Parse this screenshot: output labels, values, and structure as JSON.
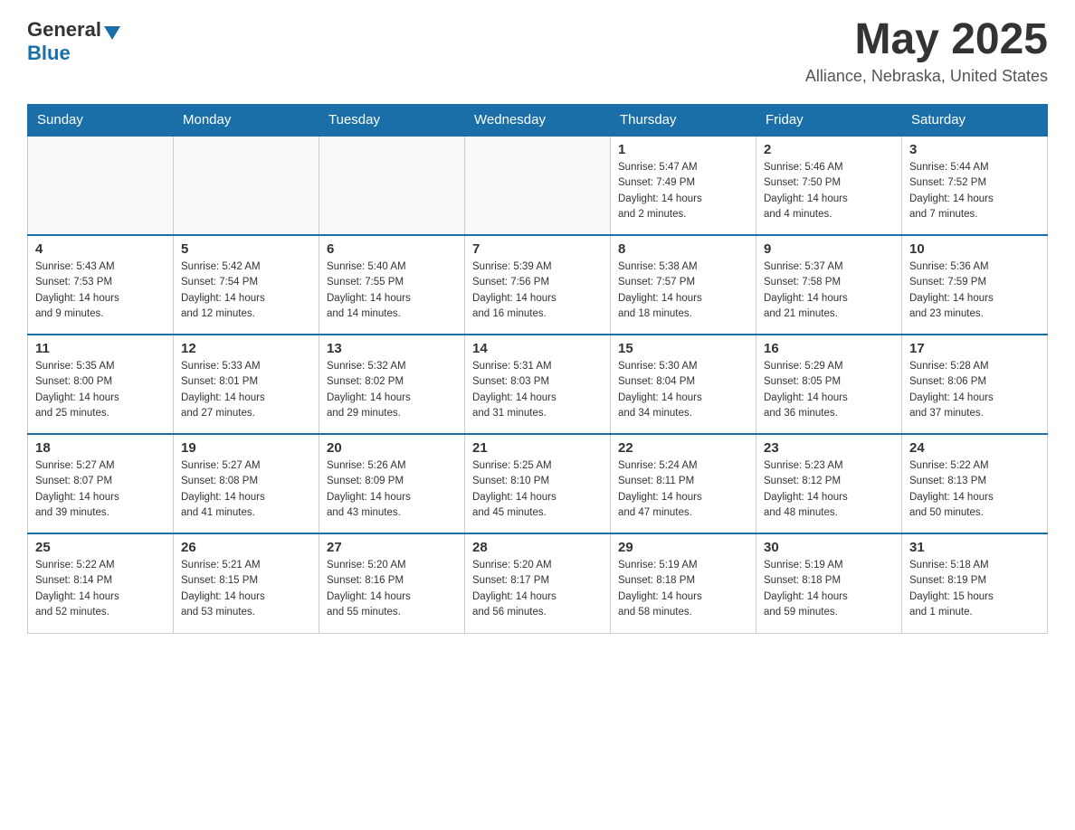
{
  "header": {
    "logo_general": "General",
    "logo_blue": "Blue",
    "month_title": "May 2025",
    "location": "Alliance, Nebraska, United States"
  },
  "days_of_week": [
    "Sunday",
    "Monday",
    "Tuesday",
    "Wednesday",
    "Thursday",
    "Friday",
    "Saturday"
  ],
  "weeks": [
    {
      "days": [
        {
          "number": "",
          "info": ""
        },
        {
          "number": "",
          "info": ""
        },
        {
          "number": "",
          "info": ""
        },
        {
          "number": "",
          "info": ""
        },
        {
          "number": "1",
          "info": "Sunrise: 5:47 AM\nSunset: 7:49 PM\nDaylight: 14 hours\nand 2 minutes."
        },
        {
          "number": "2",
          "info": "Sunrise: 5:46 AM\nSunset: 7:50 PM\nDaylight: 14 hours\nand 4 minutes."
        },
        {
          "number": "3",
          "info": "Sunrise: 5:44 AM\nSunset: 7:52 PM\nDaylight: 14 hours\nand 7 minutes."
        }
      ]
    },
    {
      "days": [
        {
          "number": "4",
          "info": "Sunrise: 5:43 AM\nSunset: 7:53 PM\nDaylight: 14 hours\nand 9 minutes."
        },
        {
          "number": "5",
          "info": "Sunrise: 5:42 AM\nSunset: 7:54 PM\nDaylight: 14 hours\nand 12 minutes."
        },
        {
          "number": "6",
          "info": "Sunrise: 5:40 AM\nSunset: 7:55 PM\nDaylight: 14 hours\nand 14 minutes."
        },
        {
          "number": "7",
          "info": "Sunrise: 5:39 AM\nSunset: 7:56 PM\nDaylight: 14 hours\nand 16 minutes."
        },
        {
          "number": "8",
          "info": "Sunrise: 5:38 AM\nSunset: 7:57 PM\nDaylight: 14 hours\nand 18 minutes."
        },
        {
          "number": "9",
          "info": "Sunrise: 5:37 AM\nSunset: 7:58 PM\nDaylight: 14 hours\nand 21 minutes."
        },
        {
          "number": "10",
          "info": "Sunrise: 5:36 AM\nSunset: 7:59 PM\nDaylight: 14 hours\nand 23 minutes."
        }
      ]
    },
    {
      "days": [
        {
          "number": "11",
          "info": "Sunrise: 5:35 AM\nSunset: 8:00 PM\nDaylight: 14 hours\nand 25 minutes."
        },
        {
          "number": "12",
          "info": "Sunrise: 5:33 AM\nSunset: 8:01 PM\nDaylight: 14 hours\nand 27 minutes."
        },
        {
          "number": "13",
          "info": "Sunrise: 5:32 AM\nSunset: 8:02 PM\nDaylight: 14 hours\nand 29 minutes."
        },
        {
          "number": "14",
          "info": "Sunrise: 5:31 AM\nSunset: 8:03 PM\nDaylight: 14 hours\nand 31 minutes."
        },
        {
          "number": "15",
          "info": "Sunrise: 5:30 AM\nSunset: 8:04 PM\nDaylight: 14 hours\nand 34 minutes."
        },
        {
          "number": "16",
          "info": "Sunrise: 5:29 AM\nSunset: 8:05 PM\nDaylight: 14 hours\nand 36 minutes."
        },
        {
          "number": "17",
          "info": "Sunrise: 5:28 AM\nSunset: 8:06 PM\nDaylight: 14 hours\nand 37 minutes."
        }
      ]
    },
    {
      "days": [
        {
          "number": "18",
          "info": "Sunrise: 5:27 AM\nSunset: 8:07 PM\nDaylight: 14 hours\nand 39 minutes."
        },
        {
          "number": "19",
          "info": "Sunrise: 5:27 AM\nSunset: 8:08 PM\nDaylight: 14 hours\nand 41 minutes."
        },
        {
          "number": "20",
          "info": "Sunrise: 5:26 AM\nSunset: 8:09 PM\nDaylight: 14 hours\nand 43 minutes."
        },
        {
          "number": "21",
          "info": "Sunrise: 5:25 AM\nSunset: 8:10 PM\nDaylight: 14 hours\nand 45 minutes."
        },
        {
          "number": "22",
          "info": "Sunrise: 5:24 AM\nSunset: 8:11 PM\nDaylight: 14 hours\nand 47 minutes."
        },
        {
          "number": "23",
          "info": "Sunrise: 5:23 AM\nSunset: 8:12 PM\nDaylight: 14 hours\nand 48 minutes."
        },
        {
          "number": "24",
          "info": "Sunrise: 5:22 AM\nSunset: 8:13 PM\nDaylight: 14 hours\nand 50 minutes."
        }
      ]
    },
    {
      "days": [
        {
          "number": "25",
          "info": "Sunrise: 5:22 AM\nSunset: 8:14 PM\nDaylight: 14 hours\nand 52 minutes."
        },
        {
          "number": "26",
          "info": "Sunrise: 5:21 AM\nSunset: 8:15 PM\nDaylight: 14 hours\nand 53 minutes."
        },
        {
          "number": "27",
          "info": "Sunrise: 5:20 AM\nSunset: 8:16 PM\nDaylight: 14 hours\nand 55 minutes."
        },
        {
          "number": "28",
          "info": "Sunrise: 5:20 AM\nSunset: 8:17 PM\nDaylight: 14 hours\nand 56 minutes."
        },
        {
          "number": "29",
          "info": "Sunrise: 5:19 AM\nSunset: 8:18 PM\nDaylight: 14 hours\nand 58 minutes."
        },
        {
          "number": "30",
          "info": "Sunrise: 5:19 AM\nSunset: 8:18 PM\nDaylight: 14 hours\nand 59 minutes."
        },
        {
          "number": "31",
          "info": "Sunrise: 5:18 AM\nSunset: 8:19 PM\nDaylight: 15 hours\nand 1 minute."
        }
      ]
    }
  ]
}
